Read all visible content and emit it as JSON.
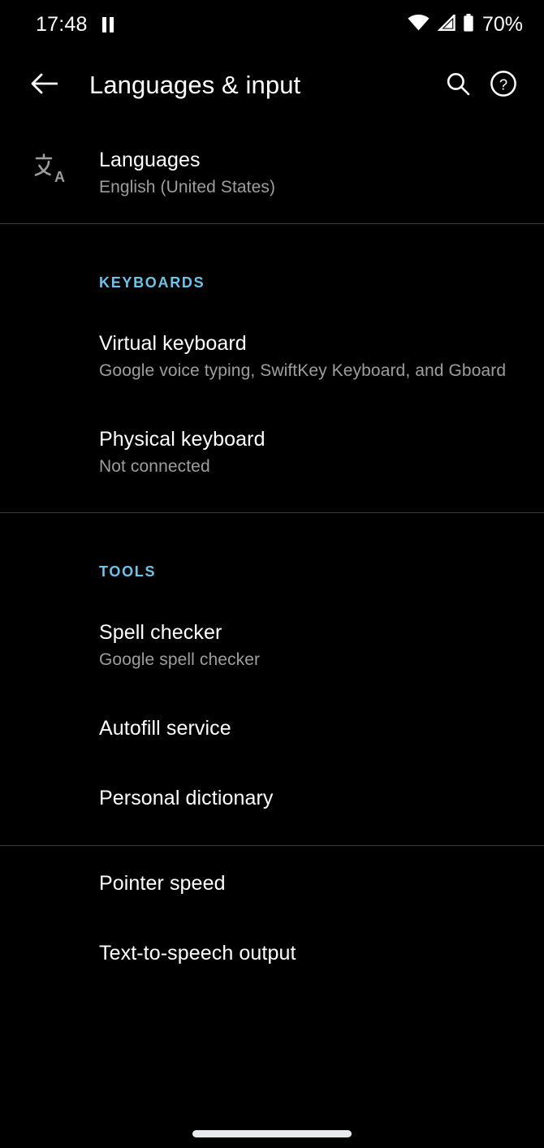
{
  "status_bar": {
    "clock": "17:48",
    "pause_icon": "pause-icon",
    "wifi_icon": "wifi-icon",
    "signal_icon": "cellular-signal-icon",
    "battery_icon": "battery-icon",
    "battery_percent": "70%"
  },
  "app_bar": {
    "back_icon": "back-arrow-icon",
    "title": "Languages & input",
    "search_icon": "search-icon",
    "help_icon": "help-icon"
  },
  "languages_row": {
    "icon": "translate-icon",
    "title": "Languages",
    "subtitle": "English (United States)"
  },
  "sections": [
    {
      "header": "KEYBOARDS",
      "items": [
        {
          "title": "Virtual keyboard",
          "subtitle": "Google voice typing, SwiftKey Keyboard, and Gboard"
        },
        {
          "title": "Physical keyboard",
          "subtitle": "Not connected"
        }
      ]
    },
    {
      "header": "TOOLS",
      "items": [
        {
          "title": "Spell checker",
          "subtitle": "Google spell checker"
        },
        {
          "title": "Autofill service",
          "subtitle": ""
        },
        {
          "title": "Personal dictionary",
          "subtitle": ""
        }
      ]
    },
    {
      "header": "",
      "items": [
        {
          "title": "Pointer speed",
          "subtitle": ""
        },
        {
          "title": "Text-to-speech output",
          "subtitle": ""
        }
      ]
    }
  ],
  "nav_bar": {
    "home_indicator": "home-gesture-indicator"
  },
  "colors": {
    "background": "#000000",
    "primary_text": "#ffffff",
    "secondary_text": "#9e9e9e",
    "accent": "#6fc3e8",
    "divider": "#3c3c3c"
  }
}
